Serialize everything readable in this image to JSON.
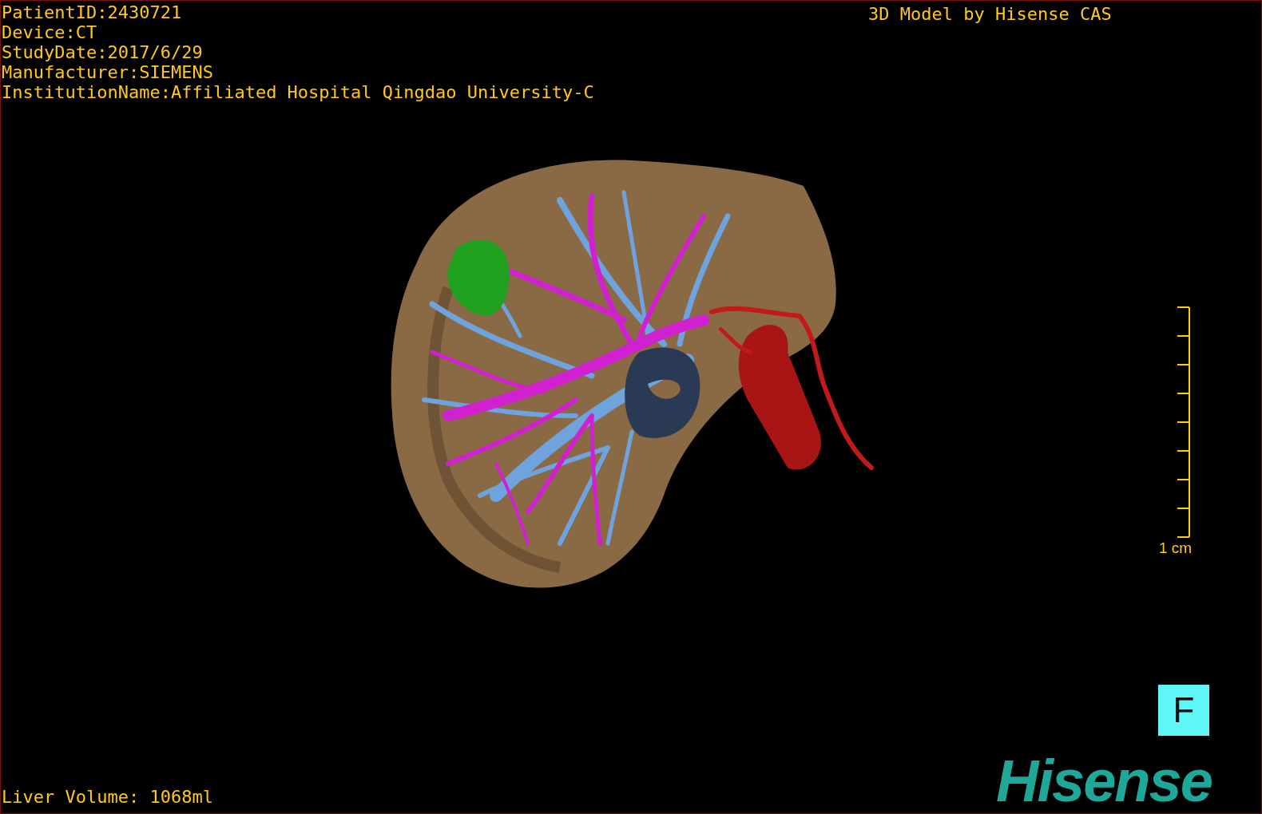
{
  "info": [
    "PatientID:2430721",
    "Device:CT",
    "StudyDate:2017/6/29",
    "Manufacturer:SIEMENS",
    "InstitutionName:Affiliated Hospital Qingdao University-C"
  ],
  "credit": "3D Model by Hisense CAS",
  "scale_bar": {
    "label": "1 cm"
  },
  "orientation_marker": "F",
  "logo": "Hisense",
  "liver_volume": "Liver Volume: 1068ml"
}
